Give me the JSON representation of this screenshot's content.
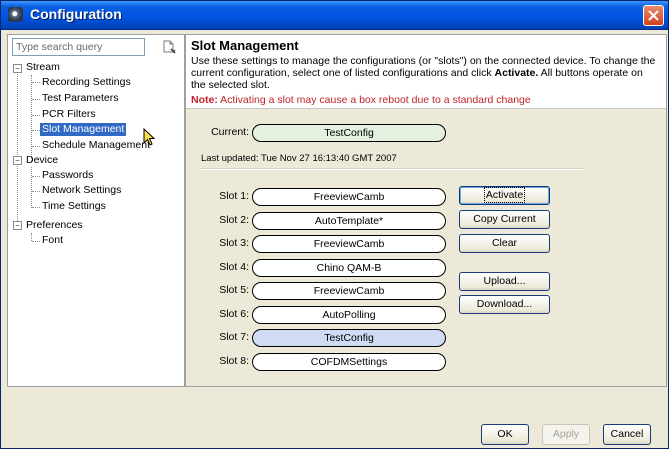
{
  "window": {
    "title": "Configuration"
  },
  "search": {
    "placeholder": "Type search query"
  },
  "tree": {
    "stream": "Stream",
    "recording_settings": "Recording Settings",
    "test_parameters": "Test Parameters",
    "pcr_filters": "PCR Filters",
    "slot_management": "Slot Management",
    "schedule_management": "Schedule Management",
    "device": "Device",
    "passwords": "Passwords",
    "network_settings": "Network Settings",
    "time_settings": "Time Settings",
    "preferences": "Preferences",
    "font": "Font"
  },
  "panel": {
    "heading": "Slot Management",
    "desc_part1": "Use these settings to manage the configurations (or \"slots\") on the connected device. To change the current configuration, select one of listed configurations and click ",
    "desc_bold": "Activate.",
    "desc_part2": " All buttons operate on the selected slot.",
    "note_label": "Note:",
    "note_text": " Activating a slot may cause a box reboot due to a standard change"
  },
  "current": {
    "label": "Current:",
    "value": "TestConfig"
  },
  "last_updated": "Last updated: Tue Nov 27 16:13:40 GMT 2007",
  "slots": [
    {
      "label": "Slot 1:",
      "value": "FreeviewCamb"
    },
    {
      "label": "Slot 2:",
      "value": "AutoTemplate*"
    },
    {
      "label": "Slot 3:",
      "value": "FreeviewCamb"
    },
    {
      "label": "Slot 4:",
      "value": "Chino QAM-B"
    },
    {
      "label": "Slot 5:",
      "value": "FreeviewCamb"
    },
    {
      "label": "Slot 6:",
      "value": "AutoPolling"
    },
    {
      "label": "Slot 7:",
      "value": "TestConfig"
    },
    {
      "label": "Slot 8:",
      "value": "COFDMSettings"
    }
  ],
  "buttons": {
    "activate": "Activate",
    "copy_current": "Copy Current",
    "clear": "Clear",
    "upload": "Upload...",
    "download": "Download...",
    "ok": "OK",
    "apply": "Apply",
    "cancel": "Cancel"
  },
  "icons": {
    "app": "app-icon",
    "close": "close-icon",
    "search": "search-icon",
    "cursor": "mouse-cursor-icon"
  },
  "colors": {
    "titlebar": "#0054e3",
    "selection": "#316ac5",
    "note": "#c0242a",
    "current_fill": "#e4f1e0",
    "active_slot_fill": "#cfdcf4"
  }
}
